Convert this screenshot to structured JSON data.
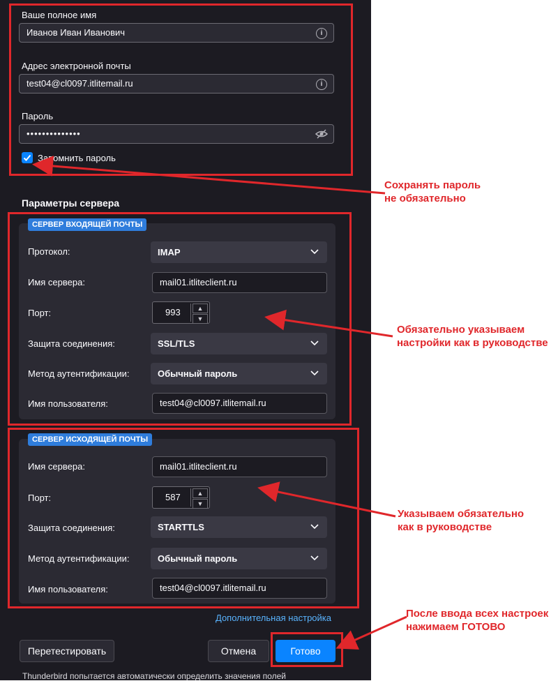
{
  "account": {
    "fullname_label": "Ваше полное имя",
    "fullname_value": "Иванов Иван Иванович",
    "email_label": "Адрес электронной почты",
    "email_value": "test04@cl0097.itlitemail.ru",
    "password_label": "Пароль",
    "password_value": "••••••••••••••",
    "remember_label": "Запомнить пароль"
  },
  "server_settings_title": "Параметры сервера",
  "incoming": {
    "legend": "СЕРВЕР ВХОДЯЩЕЙ ПОЧТЫ",
    "protocol_label": "Протокол:",
    "protocol_value": "IMAP",
    "server_label": "Имя сервера:",
    "server_value": "mail01.itliteclient.ru",
    "port_label": "Порт:",
    "port_value": "993",
    "security_label": "Защита соединения:",
    "security_value": "SSL/TLS",
    "auth_label": "Метод аутентификации:",
    "auth_value": "Обычный пароль",
    "username_label": "Имя пользователя:",
    "username_value": "test04@cl0097.itlitemail.ru"
  },
  "outgoing": {
    "legend": "СЕРВЕР ИСХОДЯЩЕЙ ПОЧТЫ",
    "server_label": "Имя сервера:",
    "server_value": "mail01.itliteclient.ru",
    "port_label": "Порт:",
    "port_value": "587",
    "security_label": "Защита соединения:",
    "security_value": "STARTTLS",
    "auth_label": "Метод аутентификации:",
    "auth_value": "Обычный пароль",
    "username_label": "Имя пользователя:",
    "username_value": "test04@cl0097.itlitemail.ru"
  },
  "advanced_link": "Дополнительная настройка",
  "buttons": {
    "retest": "Перетестировать",
    "cancel": "Отмена",
    "done": "Готово"
  },
  "footer_text": "Thunderbird попытается автоматически определить значения полей",
  "annotations": {
    "note1_line1": "Сохранять пароль",
    "note1_line2": "не обязательно",
    "note2_line1": "Обязательно указываем",
    "note2_line2": "настройки как в руководстве",
    "note3_line1": "Указываем обязательно",
    "note3_line2": "как в руководстве",
    "note4_line1": "После ввода всех настроек",
    "note4_line2": "нажимаем ГОТОВО"
  },
  "colors": {
    "panel_bg": "#1c1b22",
    "accent": "#0a84ff",
    "annotation_red": "#e0272b"
  }
}
